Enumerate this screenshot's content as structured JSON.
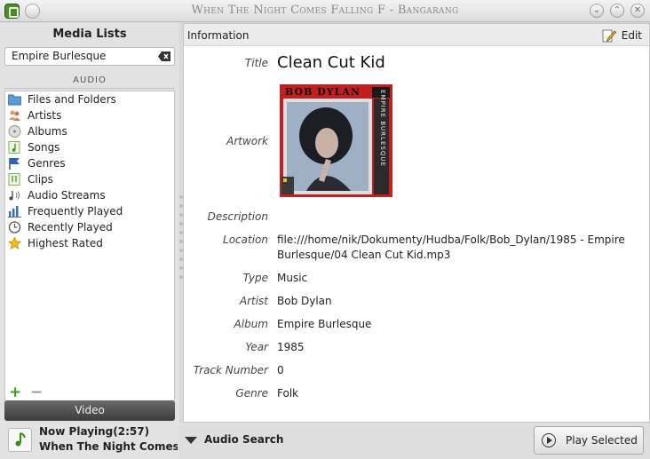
{
  "window": {
    "title": "When The Night Comes Falling F - Bangarang",
    "buttons": [
      "minimize-icon",
      "maximize-icon",
      "close-icon"
    ]
  },
  "sidebar": {
    "title": "Media Lists",
    "selector_value": "Empire Burlesque",
    "section": "AUDIO",
    "items": [
      {
        "label": "Files and Folders",
        "icon": "folder-icon"
      },
      {
        "label": "Artists",
        "icon": "artists-icon"
      },
      {
        "label": "Albums",
        "icon": "albums-icon"
      },
      {
        "label": "Songs",
        "icon": "songs-icon"
      },
      {
        "label": "Genres",
        "icon": "genres-icon"
      },
      {
        "label": "Clips",
        "icon": "clips-icon"
      },
      {
        "label": "Audio Streams",
        "icon": "audio-streams-icon"
      },
      {
        "label": "Frequently Played",
        "icon": "frequently-played-icon"
      },
      {
        "label": "Recently Played",
        "icon": "recently-played-icon"
      },
      {
        "label": "Highest Rated",
        "icon": "highest-rated-icon"
      }
    ],
    "add_label": "+",
    "remove_label": "−",
    "video_label": "Video"
  },
  "now_playing": {
    "label": "Now Playing(2:57)",
    "track": "When The Night Comes"
  },
  "info": {
    "header": "Information",
    "edit_label": "Edit",
    "fields": {
      "title_label": "Title",
      "title": "Clean Cut Kid",
      "artwork_label": "Artwork",
      "artwork_text": "BOB DYLAN",
      "artwork_side": "EMPIRE BURLESQUE",
      "description_label": "Description",
      "description": "",
      "location_label": "Location",
      "location": "file:///home/nik/Dokumenty/Hudba/Folk/Bob_Dylan/1985 - Empire Burlesque/04 Clean Cut Kid.mp3",
      "type_label": "Type",
      "type": "Music",
      "artist_label": "Artist",
      "artist": "Bob Dylan",
      "album_label": "Album",
      "album": "Empire Burlesque",
      "year_label": "Year",
      "year": "1985",
      "track_label": "Track Number",
      "track": "0",
      "genre_label": "Genre",
      "genre": "Folk"
    }
  },
  "bottom": {
    "audio_search": "Audio Search",
    "play_selected": "Play Selected"
  },
  "colors": {
    "accent_green": "#3d9b22",
    "artwork_red": "#d22"
  }
}
